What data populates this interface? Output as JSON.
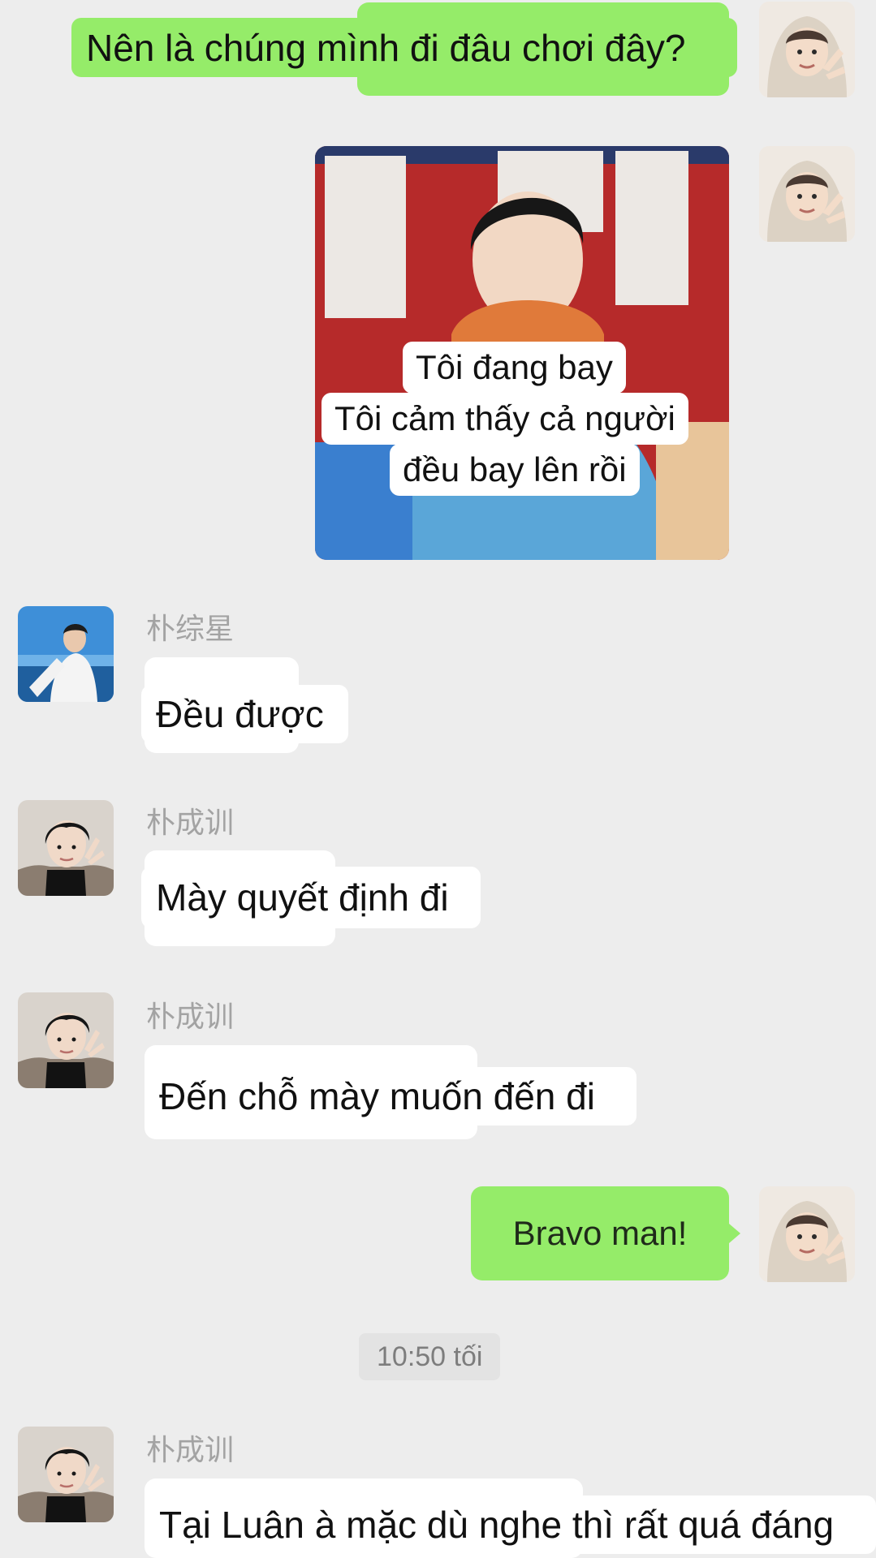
{
  "messages": {
    "m1": {
      "text": "Nên là chúng mình đi đâu chơi đây?"
    },
    "m2": {
      "caption_line1": "Tôi đang bay",
      "caption_line2": "Tôi cảm thấy cả người",
      "caption_line3": "đều bay lên rồi"
    },
    "m3": {
      "sender": "朴综星",
      "text": "Đều được"
    },
    "m4": {
      "sender": "朴成训",
      "text": "Mày quyết định đi"
    },
    "m5": {
      "sender": "朴成训",
      "text": "Đến chỗ mày muốn đến đi"
    },
    "m6": {
      "text": "Bravo man!"
    },
    "time_divider": "10:50 tối",
    "m7": {
      "sender": "朴成训",
      "text": "Tại Luân à mặc dù nghe thì rất quá đáng"
    }
  },
  "icons": {
    "self_avatar": "avatar-hoodie-peace-sign",
    "jongseong_avatar": "avatar-seaside",
    "sunghoon_avatar": "avatar-dark-hair-peace-sign"
  },
  "colors": {
    "background": "#ededed",
    "outgoing_bubble": "#95ec69",
    "incoming_bubble": "#ffffff",
    "name_gray": "#a3a3a3"
  }
}
